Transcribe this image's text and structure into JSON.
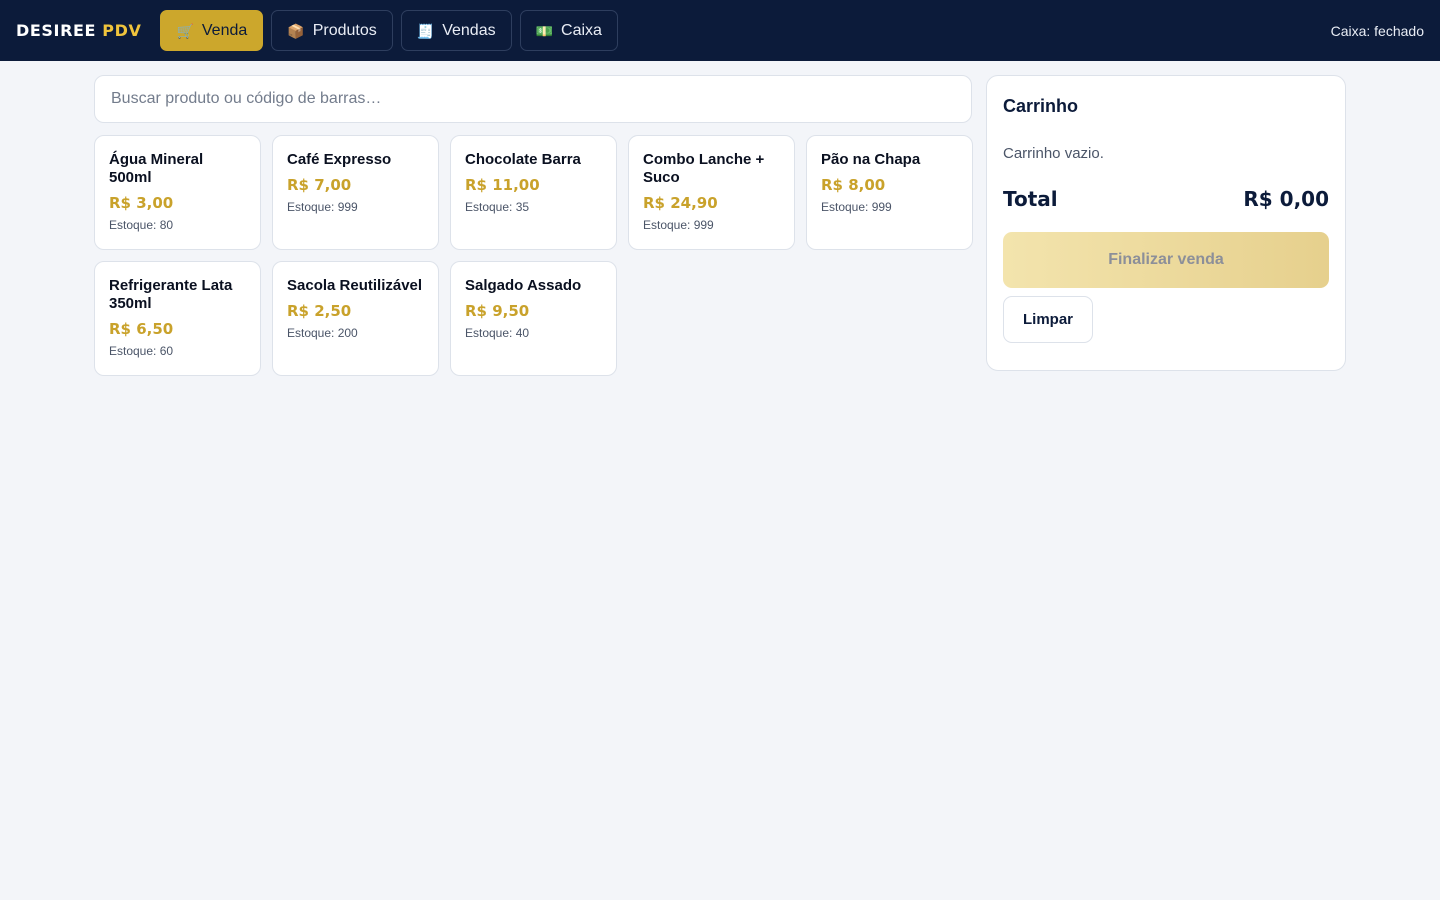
{
  "brand": {
    "name": "DESIREE",
    "accent": "PDV"
  },
  "nav": [
    {
      "label": "Venda",
      "icon": "🛒",
      "icon_name": "cart-icon",
      "active": true
    },
    {
      "label": "Produtos",
      "icon": "📦",
      "icon_name": "package-icon",
      "active": false
    },
    {
      "label": "Vendas",
      "icon": "🧾",
      "icon_name": "receipt-icon",
      "active": false
    },
    {
      "label": "Caixa",
      "icon": "💵",
      "icon_name": "cash-icon",
      "active": false
    }
  ],
  "register_status": "Caixa: fechado",
  "search": {
    "placeholder": "Buscar produto ou código de barras…",
    "value": ""
  },
  "products": [
    {
      "name": "Água Mineral 500ml",
      "price": "R$ 3,00",
      "stock": "Estoque: 80"
    },
    {
      "name": "Café Expresso",
      "price": "R$ 7,00",
      "stock": "Estoque: 999"
    },
    {
      "name": "Chocolate Barra",
      "price": "R$ 11,00",
      "stock": "Estoque: 35"
    },
    {
      "name": "Combo Lanche + Suco",
      "price": "R$ 24,90",
      "stock": "Estoque: 999"
    },
    {
      "name": "Pão na Chapa",
      "price": "R$ 8,00",
      "stock": "Estoque: 999"
    },
    {
      "name": "Refrigerante Lata 350ml",
      "price": "R$ 6,50",
      "stock": "Estoque: 60"
    },
    {
      "name": "Sacola Reutilizável",
      "price": "R$ 2,50",
      "stock": "Estoque: 200"
    },
    {
      "name": "Salgado Assado",
      "price": "R$ 9,50",
      "stock": "Estoque: 40"
    }
  ],
  "cart": {
    "title": "Carrinho",
    "empty_message": "Carrinho vazio.",
    "total_label": "Total",
    "total_value": "R$ 0,00",
    "finish_label": "Finalizar venda",
    "clear_label": "Limpar"
  },
  "colors": {
    "topbar": "#0c1b3a",
    "accent": "#cca72c",
    "price": "#c9a22b",
    "background": "#f3f5f9"
  }
}
